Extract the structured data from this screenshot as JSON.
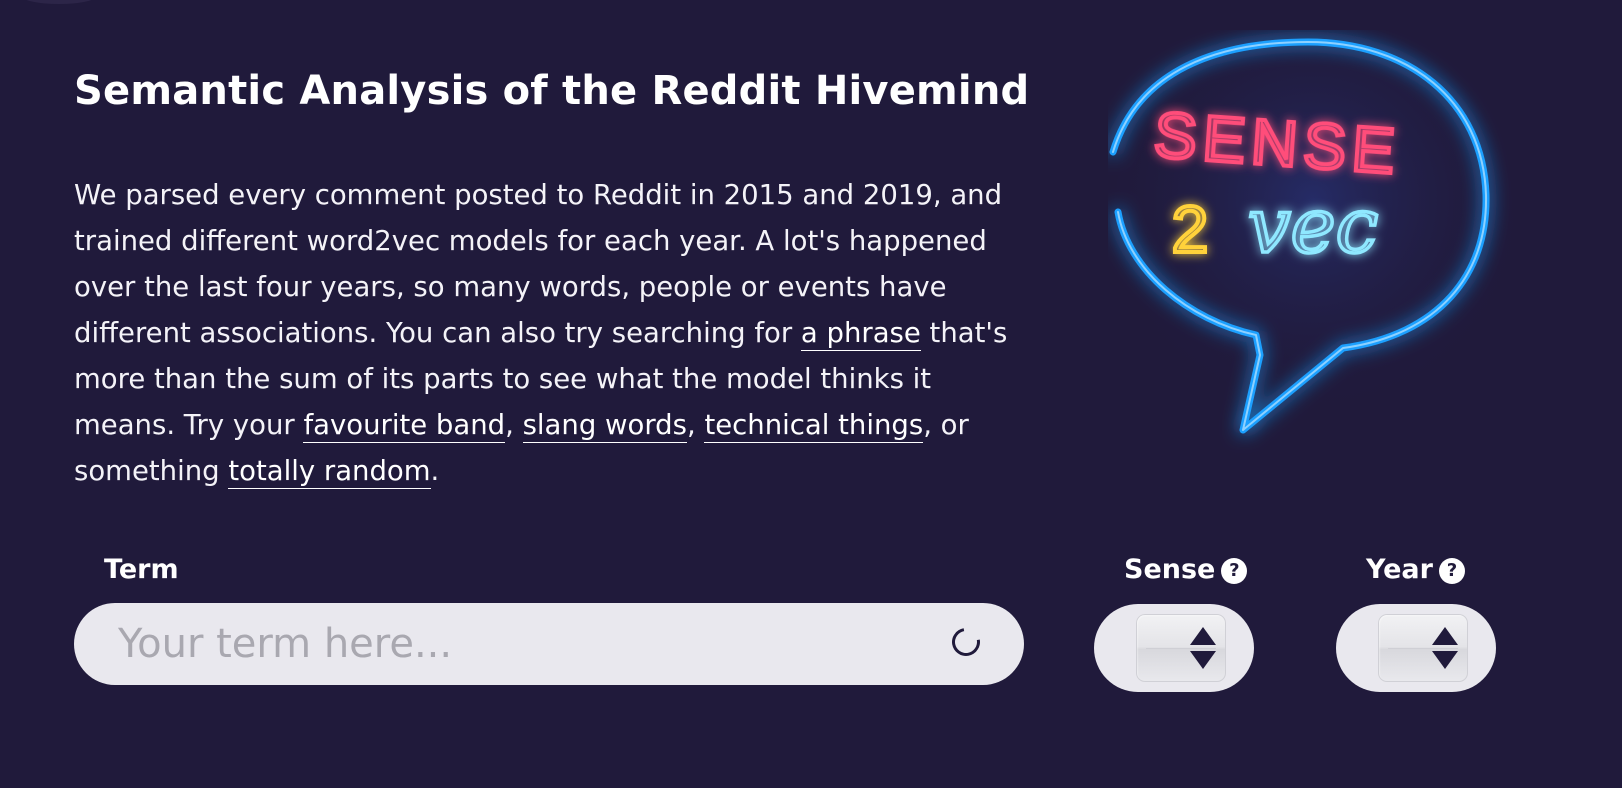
{
  "header": {
    "title": "Semantic Analysis of the Reddit Hivemind"
  },
  "intro": {
    "text_1": "We parsed every comment posted to Reddit in 2015 and 2019, and trained different word2vec models for each year. A lot's happened over the last four years, so many words, people or events have different associations. You can also try searching for ",
    "link_phrase": "a phrase",
    "text_2": " that's more than the sum of its parts to see what the model thinks it means. Try your ",
    "link_band": "favourite band",
    "sep_1": ", ",
    "link_slang": "slang words",
    "sep_2": ", ",
    "link_technical": "technical things",
    "text_3": ", or something ",
    "link_random": "totally random",
    "text_4": "."
  },
  "logo": {
    "line_1": "SENSE",
    "line_2_number": "2",
    "line_2_word": "vec",
    "colors": {
      "bubble": "#1ea0ff",
      "sense": "#ff4d7a",
      "two": "#ffd23a",
      "vec": "#8fe8ff"
    }
  },
  "form": {
    "term_label": "Term",
    "term_placeholder": "Your term here...",
    "sense_label": "Sense",
    "year_label": "Year",
    "help_glyph": "?",
    "loading_icon": "spinner-icon"
  },
  "colors": {
    "background": "#201a3b",
    "text": "#ffffff",
    "input_bg": "#e9e8ee",
    "placeholder": "#a9a8b0"
  }
}
